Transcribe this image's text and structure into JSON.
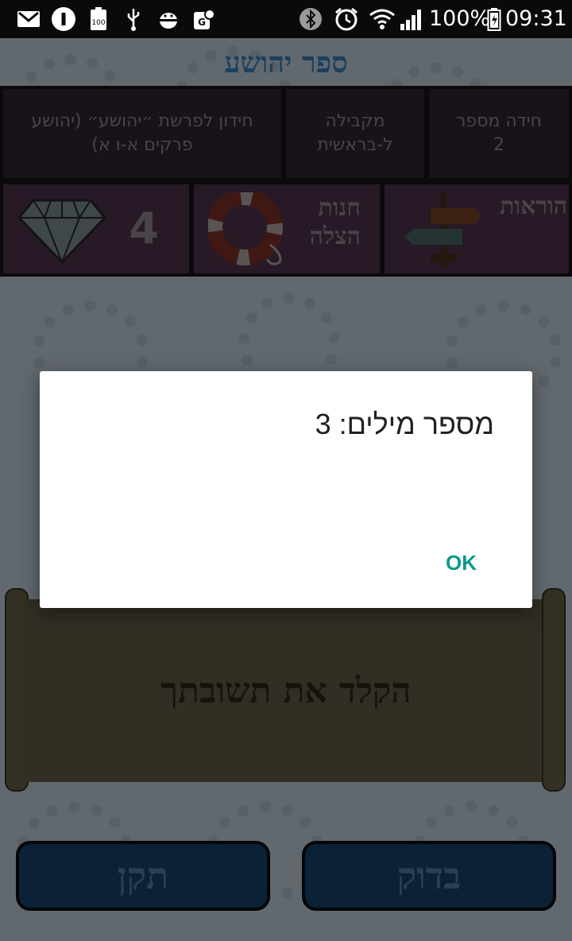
{
  "status_bar": {
    "battery_percent": "100%",
    "time": "09:31",
    "icons": [
      "gmail-icon",
      "info-icon",
      "battery-100-icon",
      "usb-icon",
      "android-debug-icon",
      "maps-icon",
      "bluetooth-icon",
      "alarm-icon",
      "wifi-icon",
      "signal-icon",
      "battery-icon"
    ]
  },
  "header": {
    "title": "ספר יהושע"
  },
  "info": {
    "riddle_number_label": "חידה מספר",
    "riddle_number": "2",
    "received_line1": "מקבילה",
    "received_line2": "ל-בראשית",
    "quiz_line1": "חידון לפרשת ״יהושע״ (יהושע",
    "quiz_line2": "פרקים א-ו א)"
  },
  "actions": {
    "instructions_label": "הוראות",
    "shop_line1": "חנות",
    "shop_line2": "הצלה",
    "gems_count": "4"
  },
  "answer": {
    "placeholder": "הקלד את תשובתך"
  },
  "buttons": {
    "check": "בדוק",
    "fix": "תקן"
  },
  "dialog": {
    "message": "מספר מילים: 3",
    "ok": "OK"
  },
  "colors": {
    "title_blue": "#2b6fa8",
    "button_blue": "#123a5e",
    "dialog_accent": "#0a9a8a"
  }
}
